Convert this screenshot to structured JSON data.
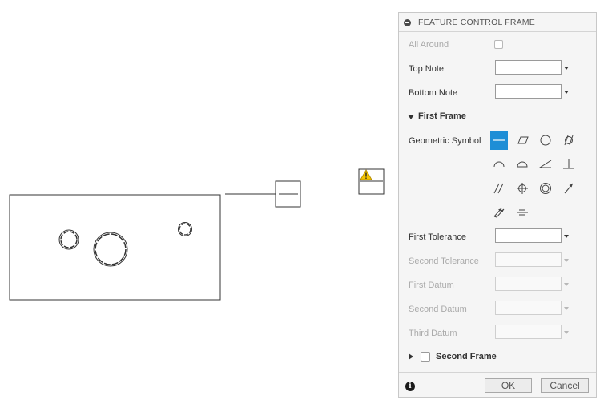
{
  "panel": {
    "title": "FEATURE CONTROL FRAME",
    "all_around_label": "All Around",
    "top_note_label": "Top Note",
    "top_note_value": "",
    "bottom_note_label": "Bottom Note",
    "bottom_note_value": "",
    "first_frame": {
      "title": "First Frame",
      "geometric_symbol_label": "Geometric Symbol",
      "symbols": [
        "straightness",
        "flatness",
        "circularity",
        "cylindricity",
        "line-profile",
        "surface-profile",
        "angularity",
        "perpendicularity",
        "parallelism",
        "position",
        "concentricity",
        "circular-runout",
        "total-runout",
        "symmetry"
      ],
      "selected_symbol": "straightness",
      "first_tolerance_label": "First Tolerance",
      "first_tolerance_value": "",
      "second_tolerance_label": "Second Tolerance",
      "first_datum_label": "First Datum",
      "second_datum_label": "Second Datum",
      "third_datum_label": "Third Datum"
    },
    "second_frame_title": "Second Frame",
    "ok_label": "OK",
    "cancel_label": "Cancel"
  },
  "colors": {
    "accent": "#1e8ed6",
    "warning": "#f5c400"
  }
}
